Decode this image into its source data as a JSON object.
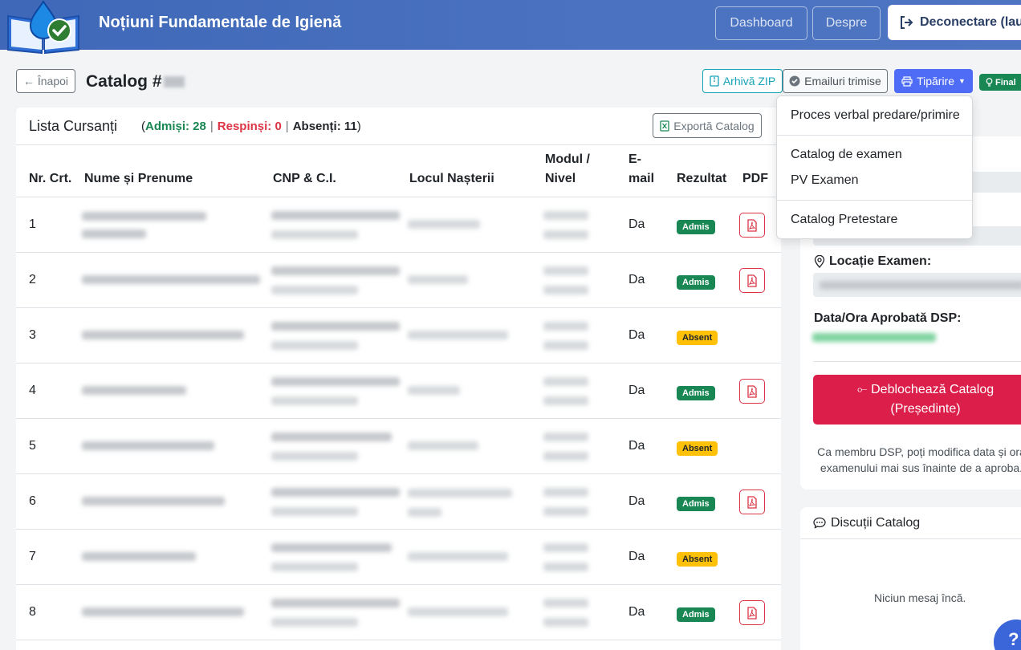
{
  "header": {
    "title": "Noțiuni Fundamentale de Igienă",
    "nav_dashboard": "Dashboard",
    "nav_despre": "Despre",
    "nav_logout": "Deconectare (lau"
  },
  "toolbar": {
    "back_label": "← Înapoi",
    "page_title": "Catalog #",
    "zip_label": "Arhivă ZIP",
    "emails_label": "Emailuri trimise",
    "print_label": "Tipărire",
    "final_label": "Final"
  },
  "list": {
    "title": "Lista Cursanți",
    "admisi_label": "Admiși: 28",
    "respinsi_label": "Respinși: 0",
    "absenti_label": "Absenți: 11",
    "export_label": "Exportă Catalog"
  },
  "table": {
    "headers": {
      "nr": "Nr. Crt.",
      "nume": "Nume și Prenume",
      "cnp": "CNP & C.I.",
      "locul": "Locul Nașterii",
      "modul_1": "Modul /",
      "modul_2": "Nivel",
      "email_1": "E-",
      "email_2": "mail",
      "rezultat": "Rezultat",
      "pdf": "PDF"
    },
    "rows": [
      {
        "nr": "1",
        "email": "Da",
        "result": "Admis"
      },
      {
        "nr": "2",
        "email": "Da",
        "result": "Admis"
      },
      {
        "nr": "3",
        "email": "Da",
        "result": "Absent"
      },
      {
        "nr": "4",
        "email": "Da",
        "result": "Admis"
      },
      {
        "nr": "5",
        "email": "Da",
        "result": "Absent"
      },
      {
        "nr": "6",
        "email": "Da",
        "result": "Admis"
      },
      {
        "nr": "7",
        "email": "Da",
        "result": "Absent"
      },
      {
        "nr": "8",
        "email": "Da",
        "result": "Admis"
      }
    ]
  },
  "dropdown": {
    "items": [
      "Proces verbal predare/primire",
      "Catalog de examen",
      "PV Examen",
      "Catalog Pretestare"
    ]
  },
  "side": {
    "location_label": "Locație Examen:",
    "dsp_label": "Data/Ora Aprobată DSP:",
    "unlock_line1": "⟜ Deblochează Catalog",
    "unlock_line2": "(Președinte)",
    "note_line1": "Ca membru DSP, poți modifica data și ora",
    "note_line2": "examenului mai sus înainte de a aproba."
  },
  "chat": {
    "title": "Discuții Catalog",
    "empty": "Niciun mesaj încă."
  },
  "help_label": "?",
  "colors": {
    "header_blue": "#4a72c0",
    "success": "#198754",
    "danger": "#dc3545",
    "warning": "#ffc107",
    "print_blue": "#4f6cf7",
    "unlock_red": "#dc1e4b"
  }
}
